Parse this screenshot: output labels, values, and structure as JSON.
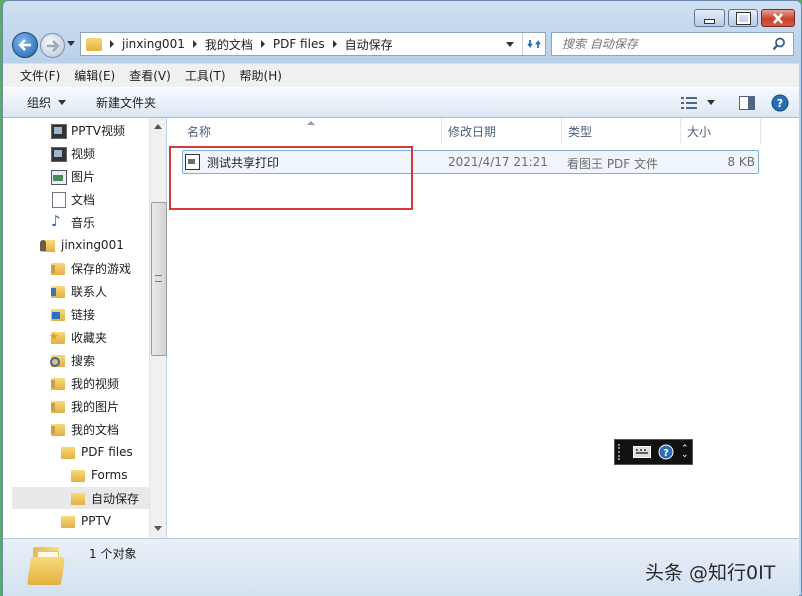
{
  "window": {
    "caption_buttons": [
      "minimize",
      "maximize",
      "close"
    ]
  },
  "address_bar": {
    "breadcrumbs": [
      "jinxing001",
      "我的文档",
      "PDF files",
      "自动保存"
    ]
  },
  "search": {
    "placeholder": "搜索 自动保存"
  },
  "menu": {
    "items": [
      "文件(F)",
      "编辑(E)",
      "查看(V)",
      "工具(T)",
      "帮助(H)"
    ]
  },
  "toolbar": {
    "organize_label": "组织",
    "new_folder_label": "新建文件夹"
  },
  "nav_pane": {
    "items": [
      {
        "label": "PPTV视频",
        "icon": "video-library-icon"
      },
      {
        "label": "视频",
        "icon": "video-library-icon"
      },
      {
        "label": "图片",
        "icon": "picture-library-icon"
      },
      {
        "label": "文档",
        "icon": "document-library-icon"
      },
      {
        "label": "音乐",
        "icon": "music-library-icon"
      },
      {
        "label": "jinxing001",
        "icon": "user-folder-icon"
      },
      {
        "label": "保存的游戏",
        "icon": "folder-icon"
      },
      {
        "label": "联系人",
        "icon": "contacts-folder-icon"
      },
      {
        "label": "链接",
        "icon": "links-folder-icon"
      },
      {
        "label": "收藏夹",
        "icon": "favorites-folder-icon"
      },
      {
        "label": "搜索",
        "icon": "search-folder-icon"
      },
      {
        "label": "我的视频",
        "icon": "folder-icon"
      },
      {
        "label": "我的图片",
        "icon": "folder-icon"
      },
      {
        "label": "我的文档",
        "icon": "folder-icon"
      },
      {
        "label": "PDF files",
        "icon": "folder-icon"
      },
      {
        "label": "Forms",
        "icon": "folder-icon"
      },
      {
        "label": "自动保存",
        "icon": "folder-icon",
        "selected": true
      },
      {
        "label": "PPTV",
        "icon": "folder-icon"
      }
    ]
  },
  "file_list": {
    "columns": [
      "名称",
      "修改日期",
      "类型",
      "大小"
    ],
    "rows": [
      {
        "name": "测试共享打印",
        "modified": "2021/4/17 21:21",
        "type": "看图王 PDF 文件",
        "size": "8 KB"
      }
    ]
  },
  "status_bar": {
    "count_text": "1 个对象"
  },
  "watermark": {
    "text": "头条 @知行0IT"
  },
  "colors": {
    "highlight_box": "#d9383a",
    "selection_row": "#e8f1fb",
    "accent": "#2a6fb6"
  }
}
